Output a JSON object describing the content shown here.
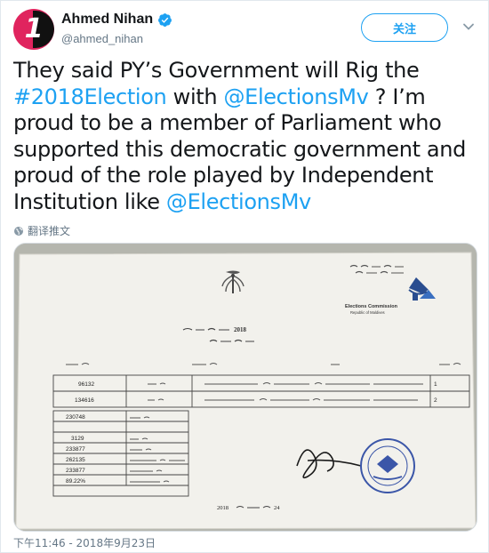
{
  "header": {
    "display_name": "Ahmed Nihan",
    "handle": "@ahmed_nihan",
    "avatar_text": "1",
    "follow_label": "关注"
  },
  "tweet": {
    "seg1": "They said PY’s Government will Rig the ",
    "hashtag": "#2018Election",
    "seg2": "  with ",
    "mention1": "@ElectionsMv",
    "seg3": " ? I’m proud to be a member of Parliament who supported this democratic government and proud of the role played by Independent Institution like ",
    "mention2": "@ElectionsMv"
  },
  "translate_label": "翻译推文",
  "timestamp": "下午11:46 - 2018年9月23日",
  "document": {
    "org_name": "Elections Commission",
    "org_sub": "Republic of Maldives",
    "year": "2018",
    "date_year": "2018",
    "date_day": "24",
    "results": [
      "96132",
      "134616"
    ],
    "row_numbers": [
      "1",
      "2"
    ],
    "totals": [
      "230748",
      "3129",
      "233877",
      "262135",
      "233877",
      "89.22%"
    ]
  },
  "colors": {
    "accent": "#1da1f2",
    "text": "#14171a",
    "muted": "#657786",
    "avatar": "#e0245e"
  }
}
